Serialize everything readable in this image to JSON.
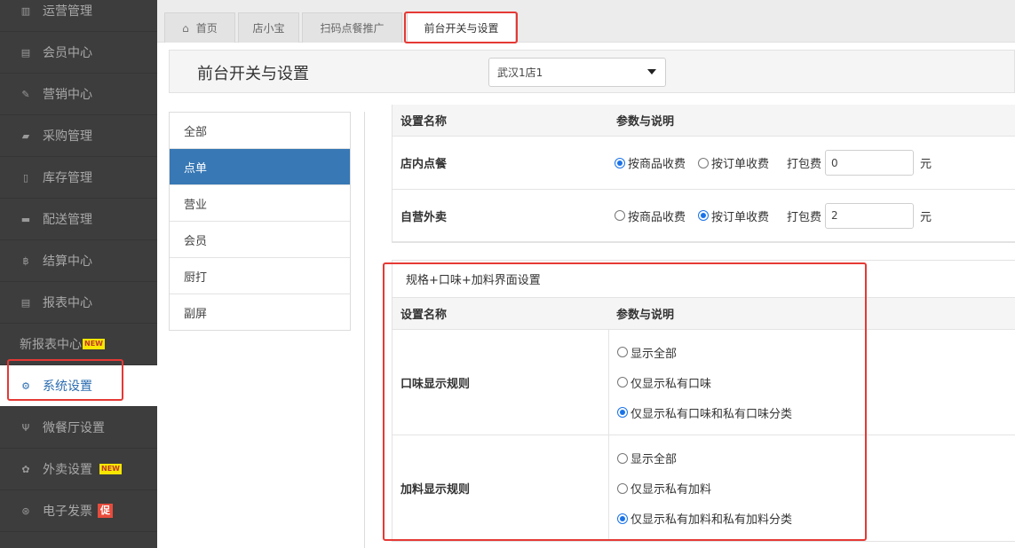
{
  "sidebar": {
    "items": [
      {
        "label": "运营管理",
        "icon": "chart-icon"
      },
      {
        "label": "会员中心",
        "icon": "id-card-icon"
      },
      {
        "label": "营销中心",
        "icon": "edit-icon"
      },
      {
        "label": "采购管理",
        "icon": "book-icon"
      },
      {
        "label": "库存管理",
        "icon": "document-icon"
      },
      {
        "label": "配送管理",
        "icon": "truck-icon"
      },
      {
        "label": "结算中心",
        "icon": "bitcoin-icon"
      },
      {
        "label": "报表中心",
        "icon": "report-icon"
      },
      {
        "label": "新报表中心",
        "badge": "NEW"
      },
      {
        "label": "系统设置",
        "icon": "gears-icon"
      },
      {
        "label": "微餐厅设置",
        "icon": "cutlery-icon"
      },
      {
        "label": "外卖设置",
        "icon": "gear-icon",
        "badge": "NEW"
      },
      {
        "label": "电子发票",
        "icon": "yen-circle-icon",
        "badge": "促"
      }
    ]
  },
  "tabs": [
    "首页",
    "店小宝",
    "扫码点餐推广",
    "前台开关与设置"
  ],
  "header": {
    "title": "前台开关与设置",
    "store": "武汉1店1"
  },
  "submenu": [
    "全部",
    "点单",
    "营业",
    "会员",
    "厨打",
    "副屏"
  ],
  "table1": {
    "col1": "设置名称",
    "col2": "参数与说明",
    "rows": [
      {
        "name": "店内点餐",
        "opt1": "按商品收费",
        "opt2": "按订单收费",
        "selected": 1,
        "pack_label": "打包费",
        "pack_value": "0",
        "unit": "元"
      },
      {
        "name": "自营外卖",
        "opt1": "按商品收费",
        "opt2": "按订单收费",
        "selected": 2,
        "pack_label": "打包费",
        "pack_value": "2",
        "unit": "元"
      }
    ]
  },
  "table2": {
    "title": "规格+口味+加料界面设置",
    "col1": "设置名称",
    "col2": "参数与说明",
    "rows": [
      {
        "name": "口味显示规则",
        "options": [
          "显示全部",
          "仅显示私有口味",
          "仅显示私有口味和私有口味分类"
        ],
        "selected": 3
      },
      {
        "name": "加料显示规则",
        "options": [
          "显示全部",
          "仅显示私有加料",
          "仅显示私有加料和私有加料分类"
        ],
        "selected": 3
      }
    ]
  },
  "colors": {
    "sidebar_bg": "#3d3d3d",
    "accent": "#3778b5",
    "highlight": "#e53935",
    "radio": "#1a73e8"
  }
}
